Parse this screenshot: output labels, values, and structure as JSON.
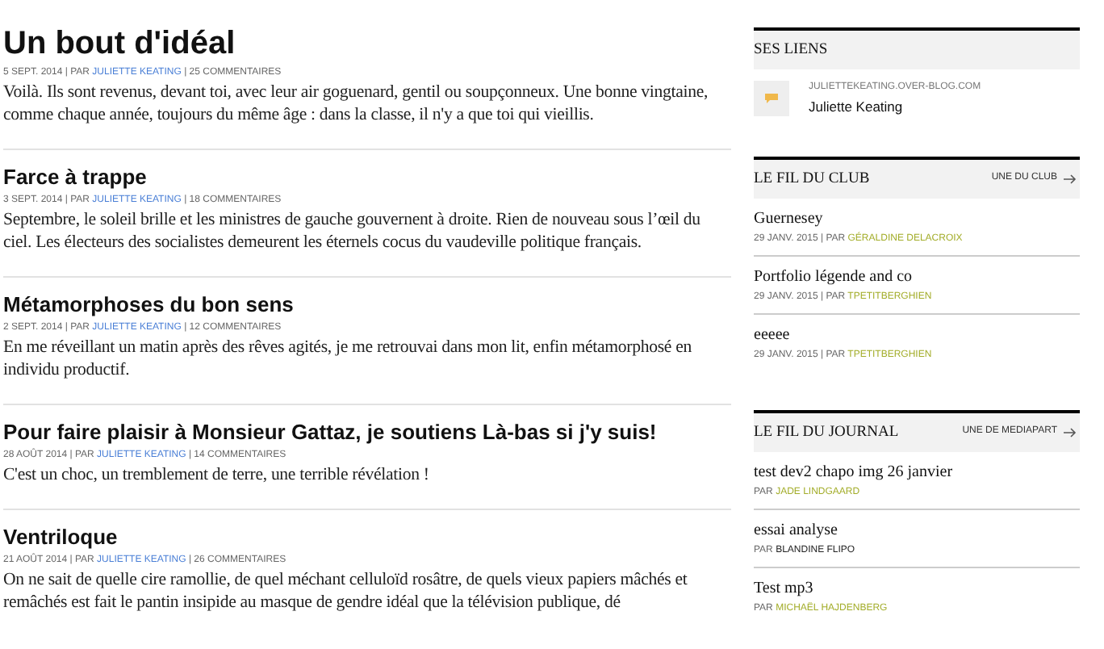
{
  "posts": [
    {
      "title": "Un bout d'idéal",
      "lead": true,
      "meta_prefix": "5 SEPT. 2014 | PAR",
      "author": "JULIETTE KEATING",
      "meta_suffix": "| 25 COMMENTAIRES",
      "excerpt": "Voilà. Ils sont revenus, devant toi, avec leur air goguenard, gentil ou soupçonneux. Une bonne vingtaine, comme chaque année, toujours du même âge : dans la classe, il n'y a que toi qui vieillis."
    },
    {
      "title": "Farce à trappe",
      "lead": false,
      "meta_prefix": "3 SEPT. 2014 | PAR",
      "author": "JULIETTE KEATING",
      "meta_suffix": "| 18 COMMENTAIRES",
      "excerpt": "Septembre, le soleil brille et les ministres de gauche gouvernent à droite. Rien de nouveau sous l’œil du ciel. Les électeurs des socialistes demeurent les éternels cocus du vaudeville politique français."
    },
    {
      "title": "Métamorphoses du bon sens",
      "lead": false,
      "meta_prefix": "2 SEPT. 2014 | PAR",
      "author": "JULIETTE KEATING",
      "meta_suffix": "| 12 COMMENTAIRES",
      "excerpt": "En me réveillant un matin après des rêves agités, je me retrouvai dans mon lit, enfin métamorphosé en individu productif."
    },
    {
      "title": "Pour faire plaisir à Monsieur Gattaz, je soutiens Là-bas si j'y suis!",
      "lead": false,
      "meta_prefix": "28 AOÛT 2014 | PAR",
      "author": "JULIETTE KEATING",
      "meta_suffix": "| 14 COMMENTAIRES",
      "excerpt": "C'est un choc, un tremblement de terre, une terrible révélation !"
    },
    {
      "title": "Ventriloque",
      "lead": false,
      "meta_prefix": "21 AOÛT 2014 | PAR",
      "author": "JULIETTE KEATING",
      "meta_suffix": "| 26 COMMENTAIRES",
      "excerpt": "On ne sait de quelle cire ramollie, de quel méchant celluloïd rosâtre, de quels vieux papiers mâchés et remâchés est fait le pantin insipide au masque de gendre idéal que la télévision publique, dé"
    }
  ],
  "sidebar": {
    "links": {
      "heading": "SES LIENS",
      "url": "JULIETTEKEATING.OVER-BLOG.COM",
      "name": "Juliette Keating"
    },
    "club": {
      "heading": "LE FIL DU CLUB",
      "more": "UNE DU CLUB",
      "items": [
        {
          "title": "Guernesey",
          "by": "29 JANV. 2015 | PAR",
          "author": "GÉRALDINE DELACROIX",
          "color": "#a3ad2a"
        },
        {
          "title": "Portfolio légende and co",
          "by": "29 JANV. 2015 | PAR",
          "author": "TPETITBERGHIEN",
          "color": "#a3ad2a"
        },
        {
          "title": "eeeee",
          "by": "29 JANV. 2015 | PAR",
          "author": "TPETITBERGHIEN",
          "color": "#a3ad2a"
        }
      ]
    },
    "journal": {
      "heading": "LE FIL DU JOURNAL",
      "more": "UNE DE MEDIAPART",
      "items": [
        {
          "title": "test dev2 chapo img 26 janvier",
          "by": "PAR",
          "author": "JADE LINDGAARD",
          "color": "#a3ad2a"
        },
        {
          "title": "essai analyse",
          "by": "PAR",
          "author": "BLANDINE FLIPO",
          "color": "#222222"
        },
        {
          "title": "Test mp3",
          "by": "PAR",
          "author": "MICHAËL HAJDENBERG",
          "color": "#a3ad2a"
        }
      ]
    }
  }
}
